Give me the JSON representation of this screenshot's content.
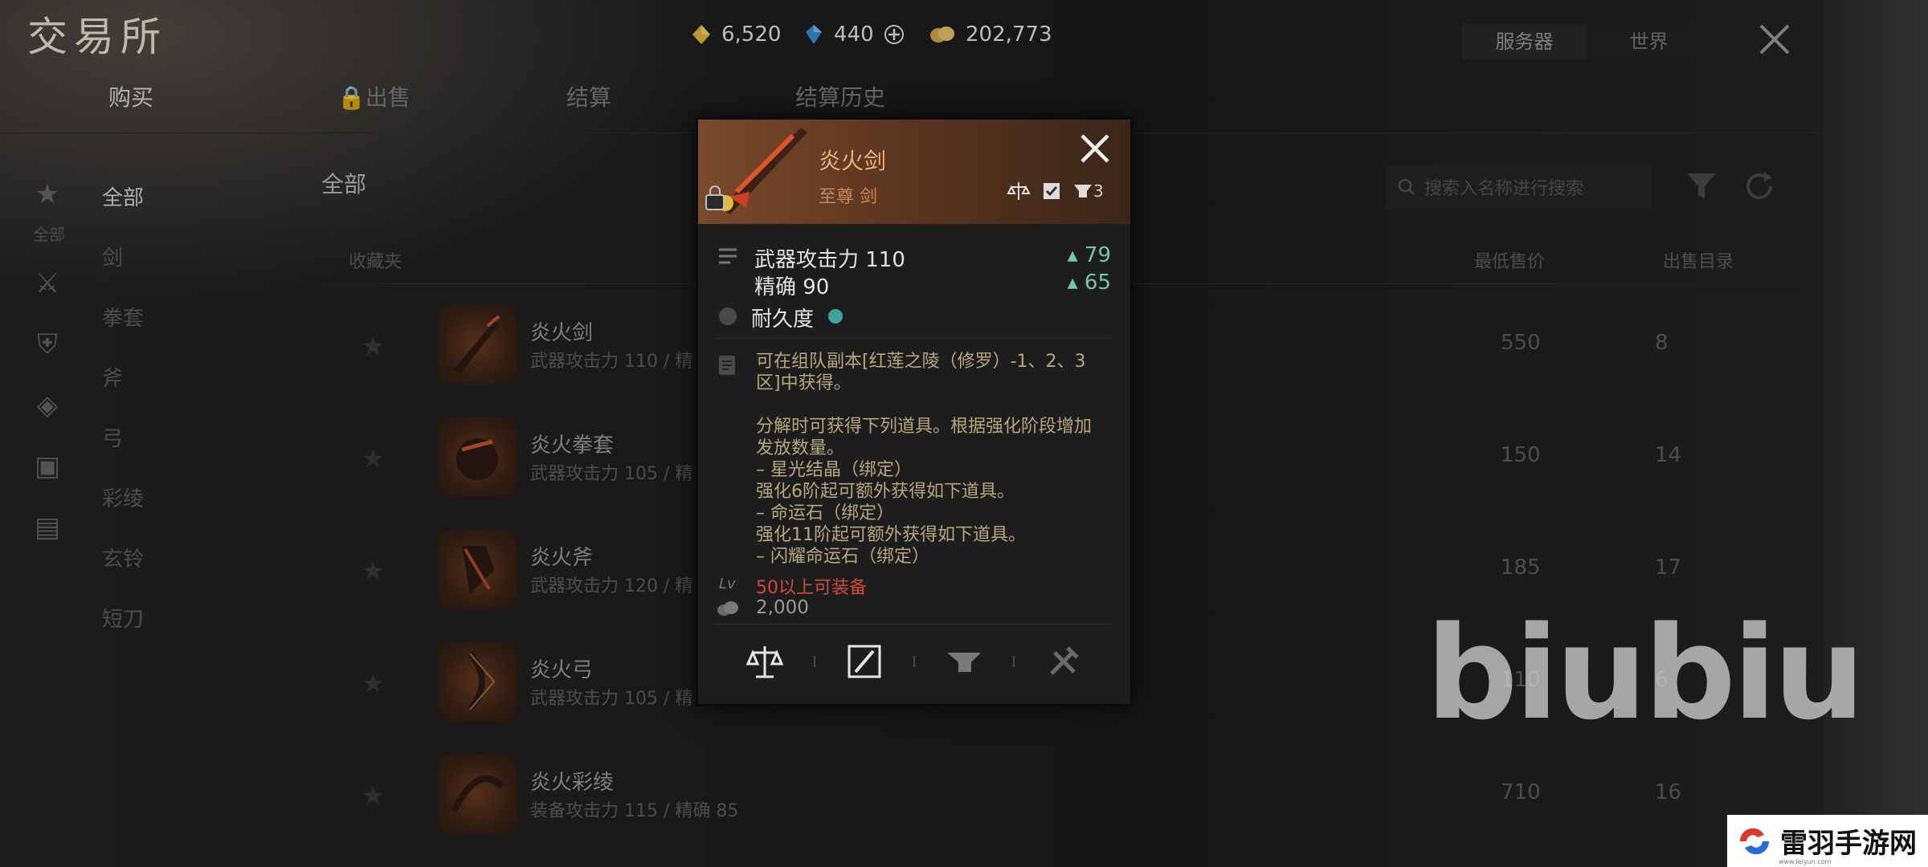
{
  "header": {
    "title": "交易所",
    "currencies": [
      {
        "icon": "gold-gem-icon",
        "value": "6,520"
      },
      {
        "icon": "blue-crystal-icon",
        "value": "440"
      },
      {
        "icon": "coin-pile-icon",
        "value": "202,773"
      }
    ],
    "server_tabs": [
      "服务器",
      "世界"
    ]
  },
  "nav": {
    "tabs": [
      "购买",
      "出售",
      "结算",
      "结算历史"
    ]
  },
  "sidebar": {
    "icon_label": "全部",
    "categories": [
      "全部",
      "剑",
      "拳套",
      "斧",
      "弓",
      "彩绫",
      "玄铃",
      "短刀"
    ]
  },
  "main": {
    "section_title": "全部",
    "search_placeholder": "搜索入名称进行搜索",
    "columns": {
      "favorites": "收藏夹",
      "lowest_price": "最低售价",
      "listings": "出售目录"
    },
    "rows": [
      {
        "name": "炎火剑",
        "sub": "武器攻击力 110  /  精",
        "price": "550",
        "qty": "8"
      },
      {
        "name": "炎火拳套",
        "sub": "武器攻击力 105  /  精",
        "price": "150",
        "qty": "14"
      },
      {
        "name": "炎火斧",
        "sub": "武器攻击力 120  /  精",
        "price": "185",
        "qty": "17"
      },
      {
        "name": "炎火弓",
        "sub": "武器攻击力 105  /  精",
        "price": "110",
        "qty": "6"
      },
      {
        "name": "炎火彩绫",
        "sub": "装备攻击力 115  /  精确 85",
        "price": "710",
        "qty": "16"
      }
    ]
  },
  "popup": {
    "name": "炎火剑",
    "grade": "至尊 剑",
    "count": "3",
    "stat1_label": "武器攻击力 110",
    "stat1_up": "79",
    "stat2_label": "精确 90",
    "stat2_up": "65",
    "durability_label": "耐久度",
    "desc_lines": [
      "可在组队副本[红莲之陵（修罗）-1、2、3",
      "区]中获得。",
      "",
      "分解时可获得下列道具。根据强化阶段增加",
      "发放数量。",
      "– 星光结晶（绑定）",
      "强化6阶起可额外获得如下道具。",
      "– 命运石（绑定）",
      "强化11阶起可额外获得如下道具。",
      "– 闪耀命运石（绑定）"
    ],
    "level_req": "50以上可装备",
    "price": "2,000",
    "level_icon": "Lv"
  },
  "watermarks": {
    "biubiu": "biubiu",
    "leiyu": "雷羽手游网",
    "leiyu_url": "www.leiyun.com"
  }
}
